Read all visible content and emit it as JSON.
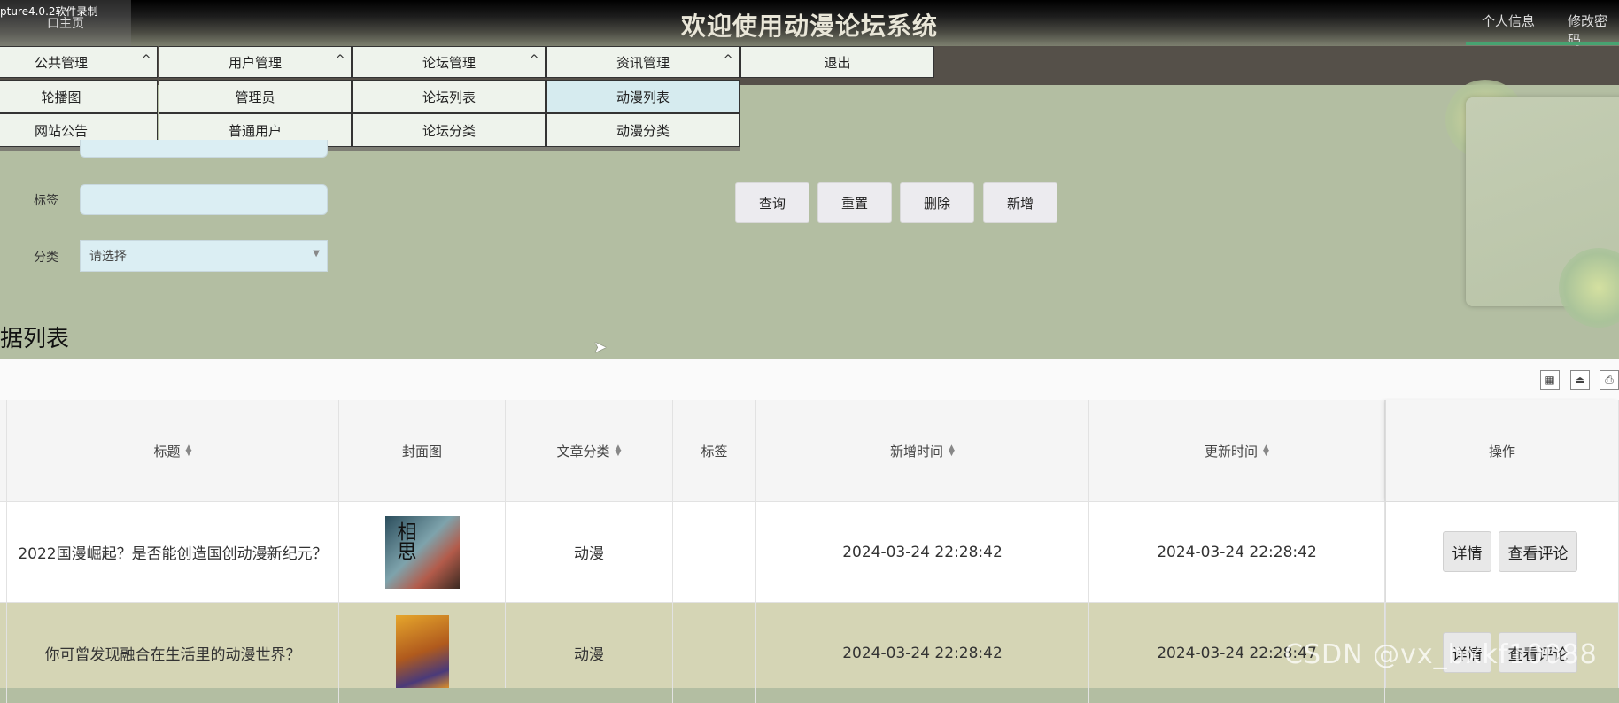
{
  "header": {
    "recording_label": "pture4.0.2软件录制",
    "home_label": "口主页",
    "title": "欢迎使用动漫论坛系统",
    "personal_info": "个人信息",
    "change_password": "修改密码"
  },
  "nav": {
    "menus": [
      {
        "label": "公共管理",
        "items": [
          "轮播图",
          "网站公告"
        ]
      },
      {
        "label": "用户管理",
        "items": [
          "管理员",
          "普通用户"
        ]
      },
      {
        "label": "论坛管理",
        "items": [
          "论坛列表",
          "论坛分类"
        ]
      },
      {
        "label": "资讯管理",
        "items": [
          "动漫列表",
          "动漫分类"
        ]
      }
    ],
    "logout": "退出"
  },
  "search": {
    "tag_label": "标签",
    "category_label": "分类",
    "category_value": "请选择"
  },
  "buttons": {
    "query": "查询",
    "reset": "重置",
    "delete": "删除",
    "add": "新增"
  },
  "section_title": "据列表",
  "table": {
    "columns": [
      "标题",
      "封面图",
      "文章分类",
      "标签",
      "新增时间",
      "更新时间",
      "操作"
    ],
    "rows": [
      {
        "title": "2022国漫崛起？是否能创造国创动漫新纪元？",
        "category": "动漫",
        "tag": "",
        "created": "2024-03-24 22:28:42",
        "updated": "2024-03-24 22:28:42"
      },
      {
        "title": "你可曾发现融合在生活里的动漫世界？",
        "category": "动漫",
        "tag": "",
        "created": "2024-03-24 22:28:42",
        "updated": "2024-03-24 22:28:47"
      }
    ],
    "action_detail": "详情",
    "action_comments": "查看评论"
  },
  "watermark": "CSDN @vx_bxkf10088",
  "cover_text": "相思"
}
